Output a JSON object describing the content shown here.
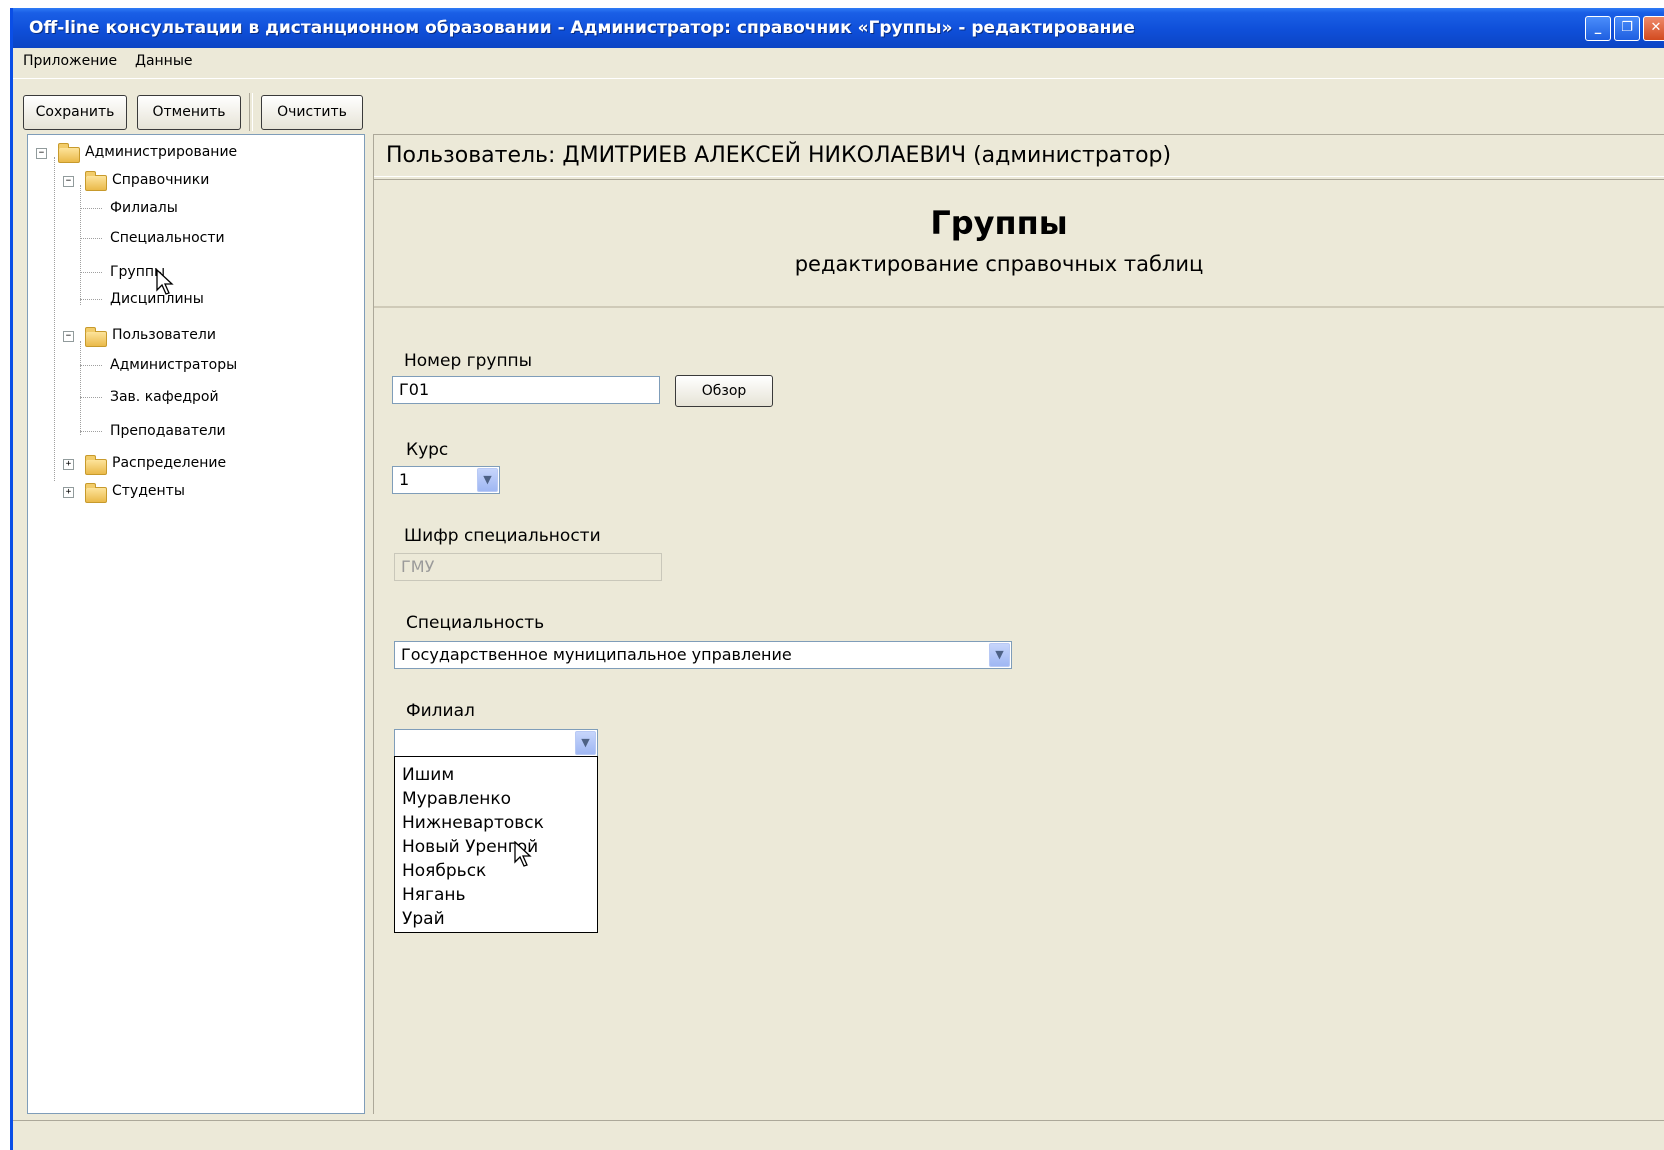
{
  "window": {
    "title": "Off-line консультации в дистанционном образовании - Администратор: справочник «Группы» - редактирование",
    "controls": {
      "minimize": "_",
      "maximize": "❐",
      "close": "✕"
    }
  },
  "menu": {
    "items": [
      "Приложение",
      "Данные"
    ]
  },
  "toolbar": {
    "save_label": "Сохранить",
    "cancel_label": "Отменить",
    "clear_label": "Очистить"
  },
  "tree": {
    "root": "Администрирование",
    "directories": "Справочники",
    "directory_items": [
      "Филиалы",
      "Специальности",
      "Группы",
      "Дисциплины"
    ],
    "users": "Пользователи",
    "user_items": [
      "Администраторы",
      "Зав. кафедрой",
      "Преподаватели"
    ],
    "distribution": "Распределение",
    "students": "Студенты",
    "expanded_symbol": "−",
    "collapsed_symbol": "+"
  },
  "user_bar": {
    "text": "Пользователь: ДМИТРИЕВ АЛЕКСЕЙ НИКОЛАЕВИЧ (администратор)"
  },
  "page": {
    "title": "Группы",
    "subtitle": "редактирование справочных таблиц"
  },
  "form": {
    "group_number": {
      "label": "Номер группы",
      "value": "Г01",
      "browse_label": "Обзор"
    },
    "course": {
      "label": "Курс",
      "value": "1"
    },
    "specialty_code": {
      "label": "Шифр специальности",
      "value": "ГМУ"
    },
    "specialty": {
      "label": "Специальность",
      "value": "Государственное муниципальное управление"
    },
    "branch": {
      "label": "Филиал",
      "value": "",
      "options": [
        "Ишим",
        "Муравленко",
        "Нижневартовск",
        "Новый Уренгой",
        "Ноябрьск",
        "Нягань",
        "Урай"
      ]
    }
  },
  "colors": {
    "titlebar": "#0f4fd9",
    "window_bg": "#ece9d8",
    "border": "#7f9db9"
  }
}
